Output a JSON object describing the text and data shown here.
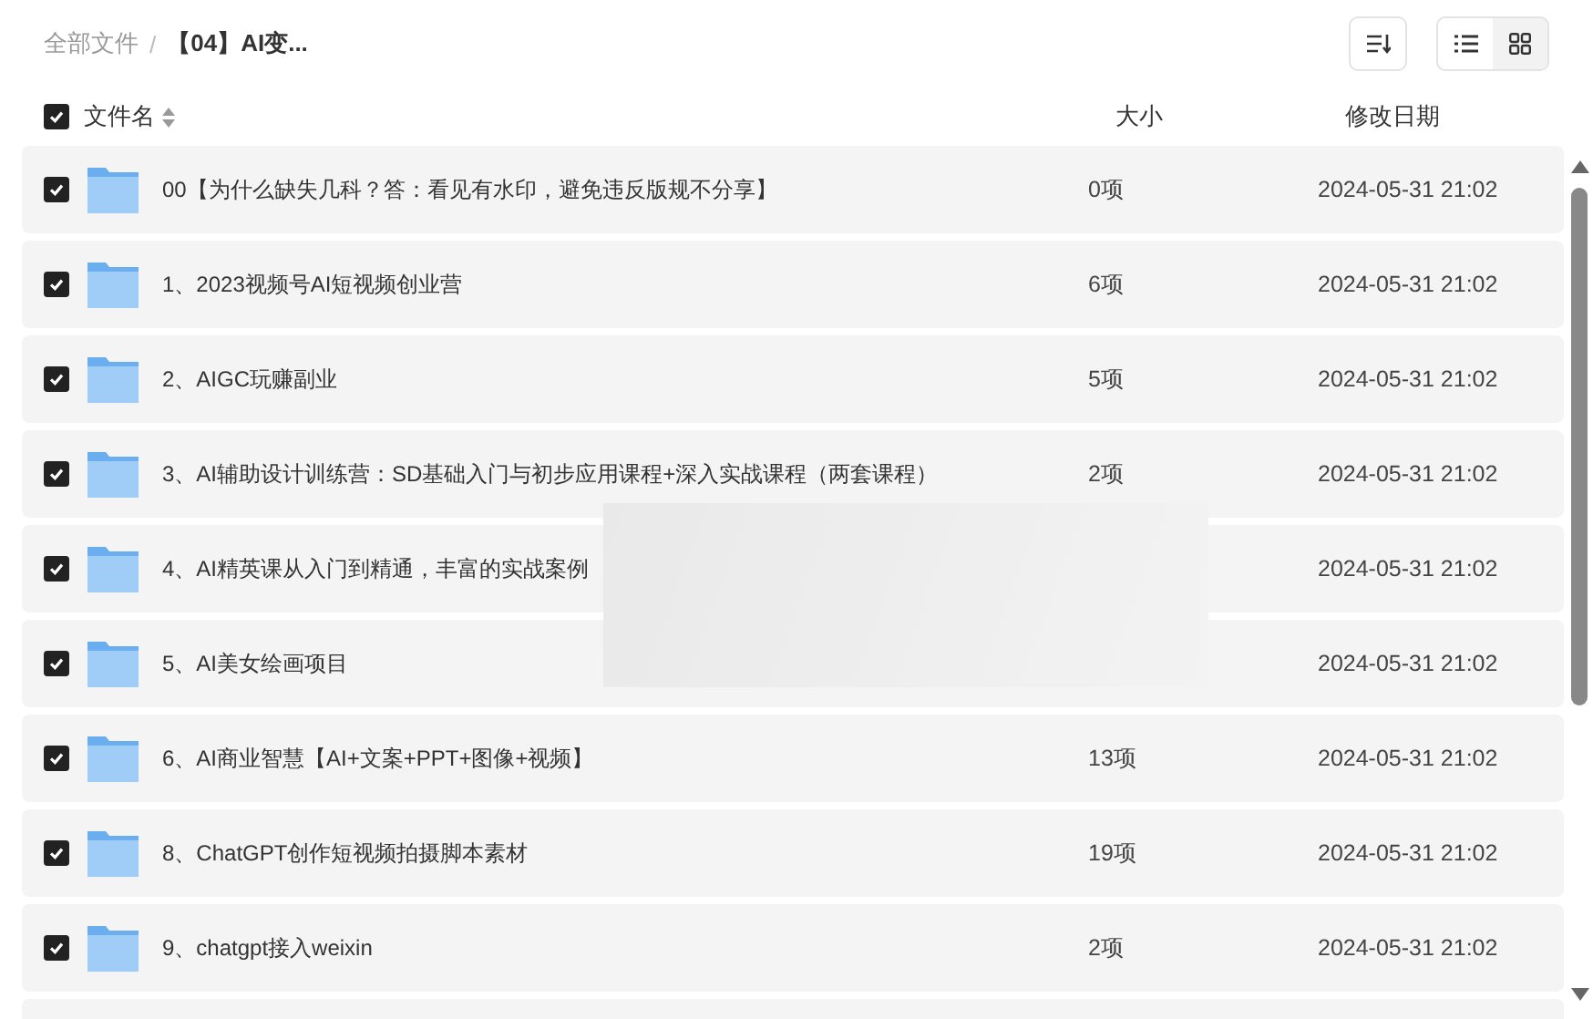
{
  "breadcrumb": {
    "root": "全部文件",
    "separator": "/",
    "current": "【04】AI变..."
  },
  "toolbar": {
    "view_modes": [
      {
        "kind": "list",
        "selected": true
      },
      {
        "kind": "grid",
        "selected": false
      }
    ]
  },
  "table": {
    "select_all_checked": true,
    "columns": [
      "文件名",
      "大小",
      "修改日期"
    ],
    "rows": [
      {
        "checked": true,
        "name": "00【为什么缺失几科？答：看见有水印，避免违反版规不分享】",
        "size": "0项",
        "date": "2024-05-31 21:02"
      },
      {
        "checked": true,
        "name": "1、2023视频号AI短视频创业营",
        "size": "6项",
        "date": "2024-05-31 21:02"
      },
      {
        "checked": true,
        "name": "2、AIGC玩赚副业",
        "size": "5项",
        "date": "2024-05-31 21:02"
      },
      {
        "checked": true,
        "name": "3、AI辅助设计训练营：SD基础入门与初步应用课程+深入实战课程（两套课程）",
        "size": "2项",
        "date": "2024-05-31 21:02"
      },
      {
        "checked": true,
        "name": "4、AI精英课从入门到精通，丰富的实战案例",
        "date": "2024-05-31 21:02"
      },
      {
        "checked": true,
        "name": "5、AI美女绘画项目",
        "date": "2024-05-31 21:02"
      },
      {
        "checked": true,
        "name": "6、AI商业智慧【AI+文案+PPT+图像+视频】",
        "size": "13项",
        "date": "2024-05-31 21:02"
      },
      {
        "checked": true,
        "name": "8、ChatGPT创作短视频拍摄脚本素材",
        "size": "19项",
        "date": "2024-05-31 21:02"
      },
      {
        "checked": true,
        "name": "9、chatgpt接入weixin",
        "size": "2项",
        "date": "2024-05-31 21:02"
      }
    ]
  }
}
